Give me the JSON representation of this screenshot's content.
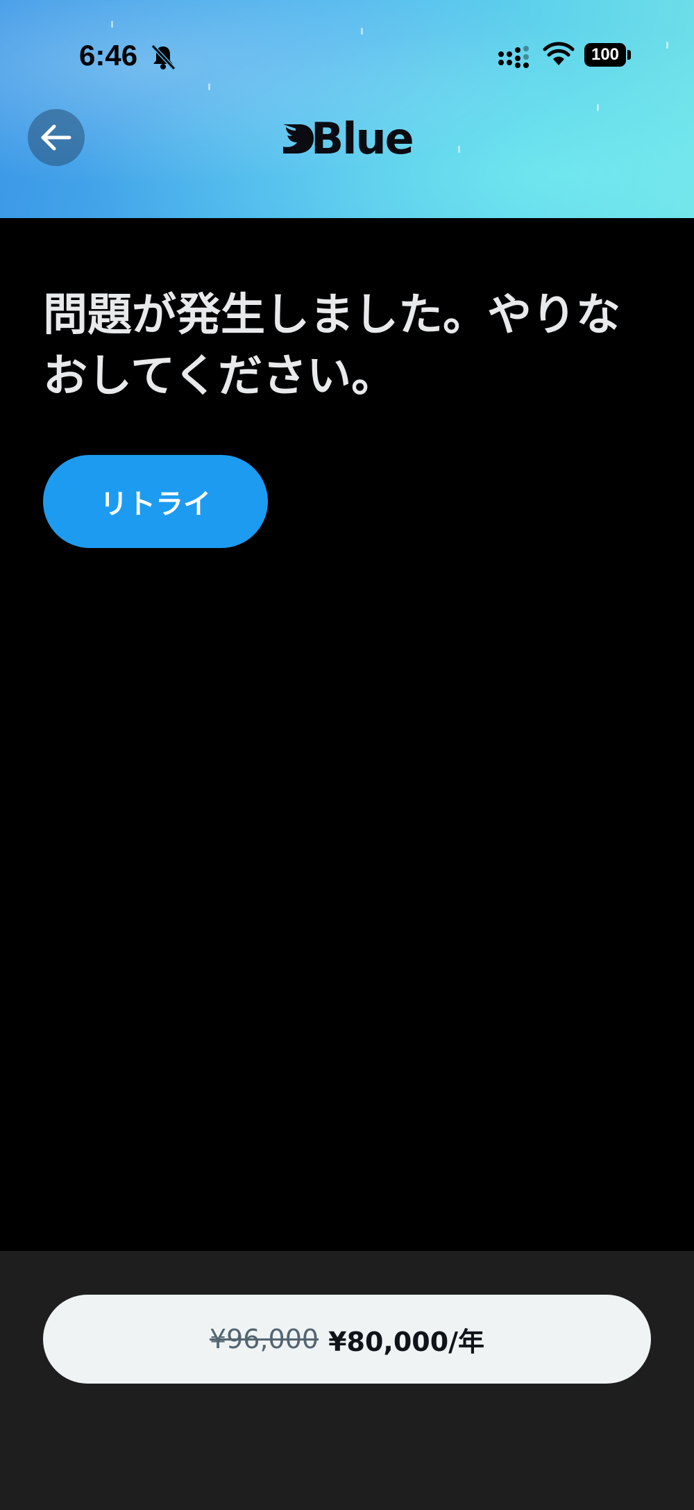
{
  "status_bar": {
    "time": "6:46",
    "battery": "100"
  },
  "header": {
    "logo_text": "Blue"
  },
  "error": {
    "message": "問題が発生しました。やりなおしてください。",
    "retry_label": "リトライ"
  },
  "pricing": {
    "original_price": "¥96,000",
    "sale_price": "¥80,000/年"
  },
  "colors": {
    "accent": "#1d9bf0",
    "background": "#000000",
    "panel": "#1e1e1e"
  }
}
